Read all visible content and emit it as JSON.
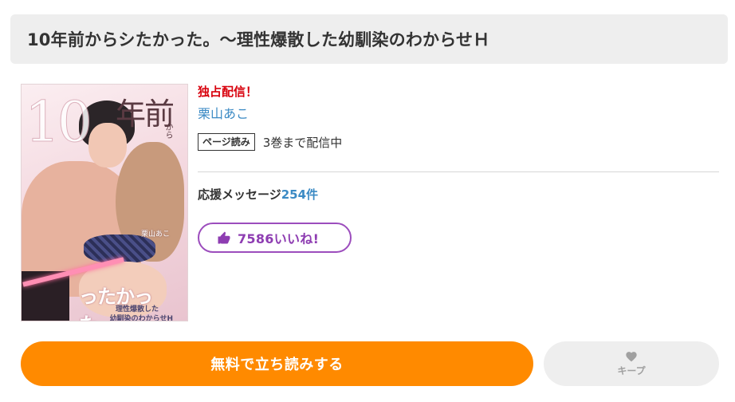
{
  "title": "10年前からシたかった。～理性爆散した幼馴染のわからせＨ",
  "cover_art": {
    "number": "10",
    "kanji": "年前",
    "side_text": "から",
    "author_mark": "栗山あこ",
    "handwritten": "ったかった。",
    "subtitle_line1": "理性爆散した",
    "subtitle_line2": "幼馴染のわからせH"
  },
  "info": {
    "exclusive_label": "独占配信！",
    "author": "栗山あこ",
    "format_badge": "ページ読み",
    "distribution": "3巻まで配信中",
    "support_label": "応援メッセージ",
    "support_count": "254件"
  },
  "like_button": {
    "label": "7586いいね!",
    "icon": "thumbs-up-icon"
  },
  "actions": {
    "read_free_label": "無料で立ち読みする",
    "keep_label": "キープ",
    "keep_icon": "heart-icon"
  },
  "colors": {
    "accent_orange": "#ff8a00",
    "like_purple": "#9c4dbd",
    "exclusive_red": "#d8000c",
    "link_blue": "#3b8ac4"
  }
}
